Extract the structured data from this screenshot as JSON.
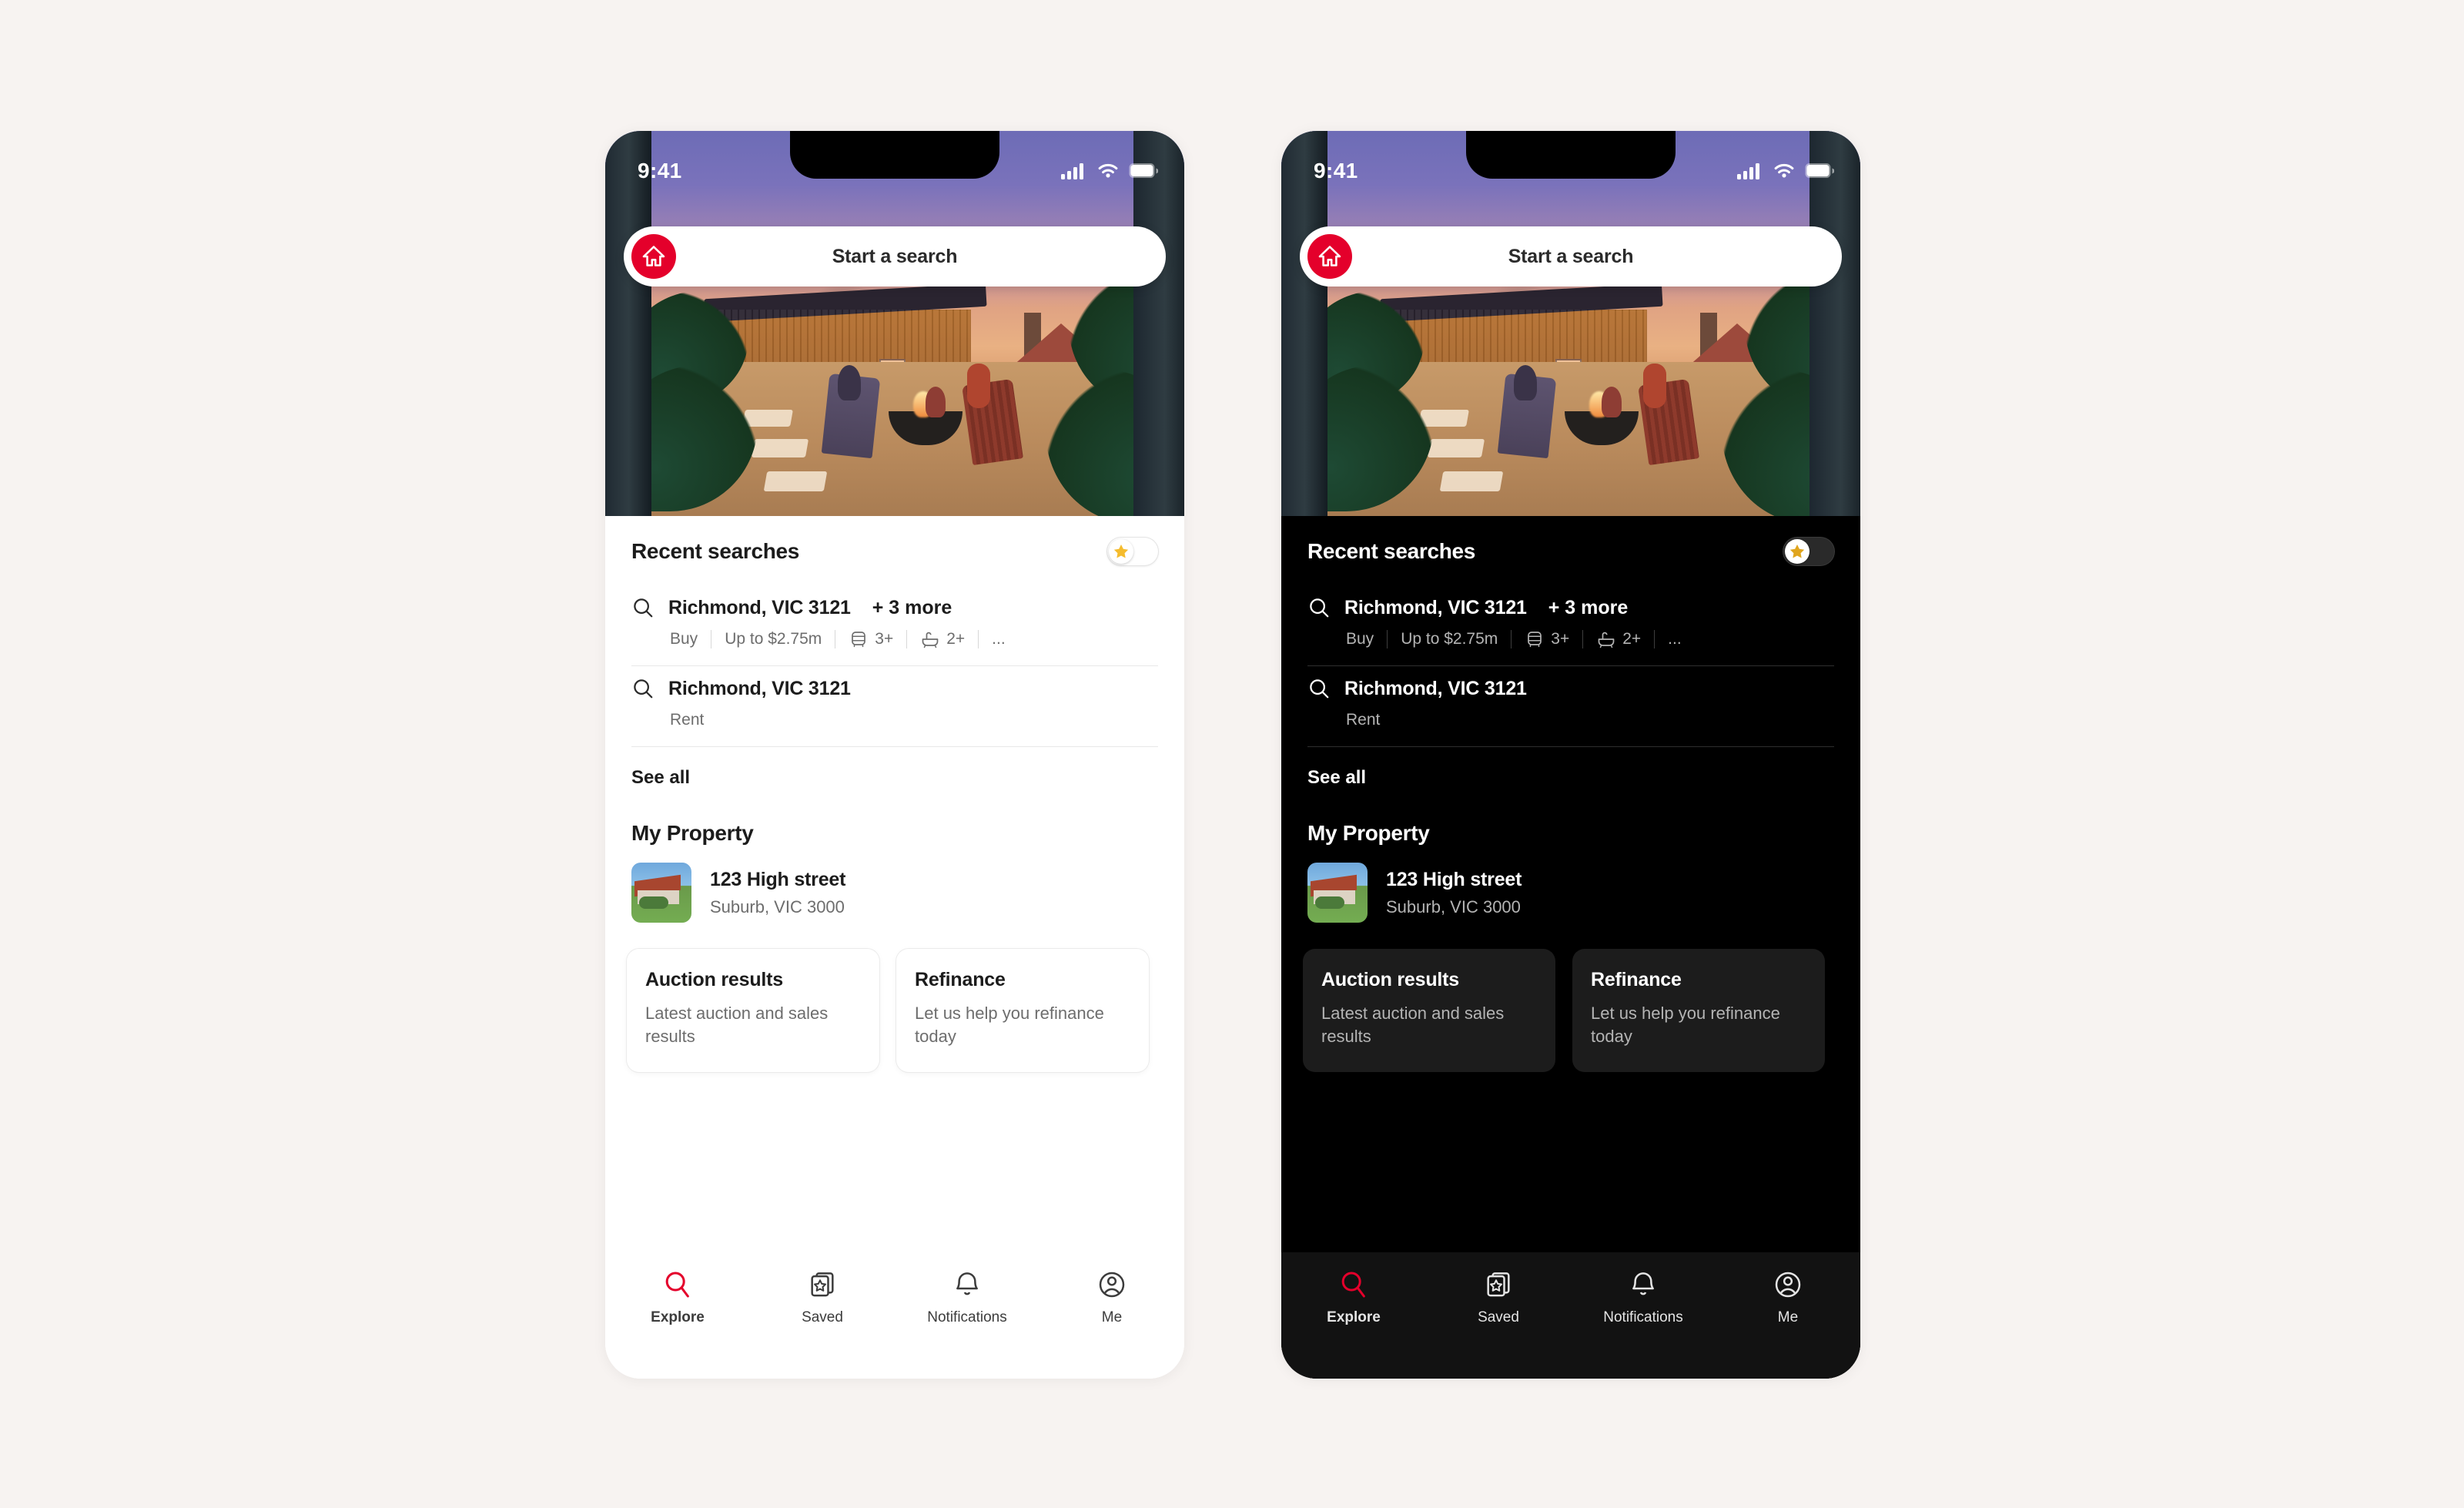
{
  "canvas": {
    "background": "#f7f3f1"
  },
  "theme": {
    "brand_red": "#e4002b",
    "star_gold": "#f5bc2e",
    "light_bg": "#ffffff",
    "dark_bg": "#000000",
    "dark_card": "#1c1c1c",
    "light_muted": "#6d6d6d",
    "dark_muted": "#b4b4b4"
  },
  "status_bar": {
    "time": "9:41",
    "icons": [
      "cellular-signal-icon",
      "wifi-icon",
      "battery-icon"
    ]
  },
  "search": {
    "logo": "realestate-house-logo",
    "placeholder": "Start a search",
    "label": "Start a search"
  },
  "hero": {
    "alt": "backyard-dusk-illustration"
  },
  "recent_searches": {
    "title": "Recent searches",
    "toggle": {
      "name": "saved-searches-toggle",
      "icon": "star-icon",
      "state": "off"
    },
    "items": [
      {
        "search_icon": "search-icon",
        "location": "Richmond, VIC 3121",
        "more": "+ 3 more",
        "meta": [
          {
            "type": "text",
            "label": "Buy"
          },
          {
            "type": "text",
            "label": "Up to $2.75m"
          },
          {
            "type": "icon",
            "icon": "bed-icon",
            "label": "3+"
          },
          {
            "type": "icon",
            "icon": "bath-icon",
            "label": "2+"
          },
          {
            "type": "text",
            "label": "..."
          }
        ]
      },
      {
        "search_icon": "search-icon",
        "location": "Richmond, VIC 3121",
        "more": "",
        "meta": [
          {
            "type": "text",
            "label": "Rent"
          }
        ]
      }
    ],
    "see_all": "See all"
  },
  "my_property": {
    "title": "My Property",
    "property": {
      "thumbnail": "house-photo-thumbnail",
      "name": "123 High street",
      "address": "Suburb, VIC 3000"
    },
    "cards": [
      {
        "title": "Auction results",
        "description": "Latest auction and sales results"
      },
      {
        "title": "Refinance",
        "description": "Let us help you refinance today"
      }
    ]
  },
  "tab_bar": {
    "items": [
      {
        "label": "Explore",
        "icon": "search-icon",
        "active": true
      },
      {
        "label": "Saved",
        "icon": "saved-star-cards-icon",
        "active": false
      },
      {
        "label": "Notifications",
        "icon": "bell-icon",
        "active": false
      },
      {
        "label": "Me",
        "icon": "person-circle-icon",
        "active": false
      }
    ]
  }
}
